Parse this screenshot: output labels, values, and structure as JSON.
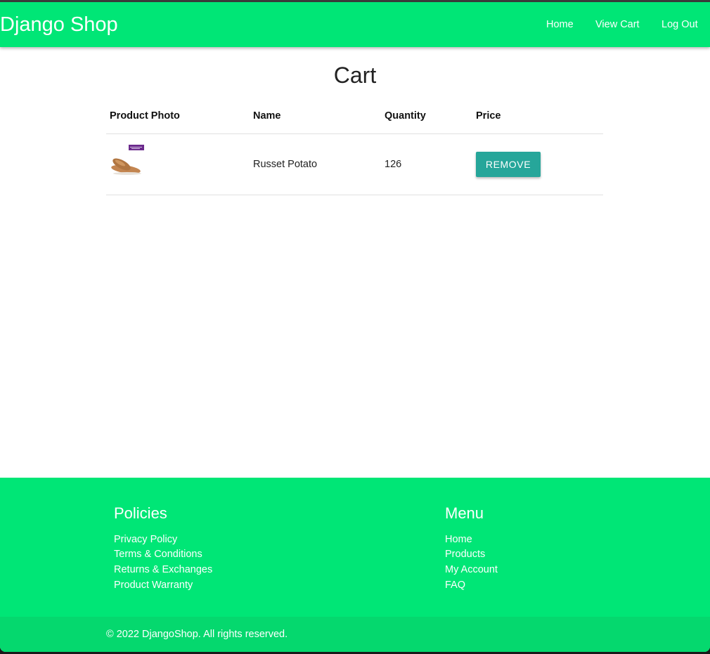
{
  "navbar": {
    "brand": "Django Shop",
    "links": [
      "Home",
      "View Cart",
      "Log Out"
    ]
  },
  "cart": {
    "title": "Cart",
    "columns": [
      "Product Photo",
      "Name",
      "Quantity",
      "Price"
    ],
    "rows": [
      {
        "name": "Russet Potato",
        "quantity": "126",
        "action": "REMOVE"
      }
    ]
  },
  "footer": {
    "policies": {
      "heading": "Policies",
      "links": [
        "Privacy Policy",
        "Terms & Conditions",
        "Returns & Exchanges",
        "Product Warranty"
      ]
    },
    "menu": {
      "heading": "Menu",
      "links": [
        "Home",
        "Products",
        "My Account",
        "FAQ"
      ]
    },
    "copyright": "© 2022 DjangoShop. All rights reserved."
  },
  "colors": {
    "primary": "#00e676",
    "footer_bottom": "#05d86e",
    "button": "#26a69a"
  },
  "icons": {
    "product_photo": "potato-image"
  }
}
